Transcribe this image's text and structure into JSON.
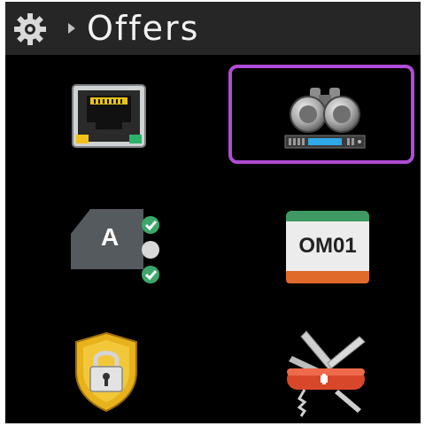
{
  "header": {
    "title": "Offers",
    "settings_icon": "gear-icon",
    "breadcrumb_icon": "chevron-right-icon"
  },
  "tiles": [
    {
      "name": "ethernet-port",
      "icon": "ethernet-port-icon",
      "selected": false
    },
    {
      "name": "discovery",
      "icon": "binoculars-icon",
      "selected": true
    },
    {
      "name": "account-checks",
      "icon": "account-checklist-icon",
      "label": "A",
      "selected": false
    },
    {
      "name": "om01",
      "icon": "om01-badge-icon",
      "label": "OM01",
      "selected": false
    },
    {
      "name": "security",
      "icon": "lock-shield-icon",
      "selected": false
    },
    {
      "name": "tools",
      "icon": "multitool-knife-icon",
      "selected": false
    }
  ],
  "colors": {
    "background": "#000000",
    "header": "#262626",
    "selection": "#b04cd6",
    "om_green": "#3e9a62",
    "om_orange": "#e06a2a",
    "shield_gold": "#e8b21c"
  }
}
